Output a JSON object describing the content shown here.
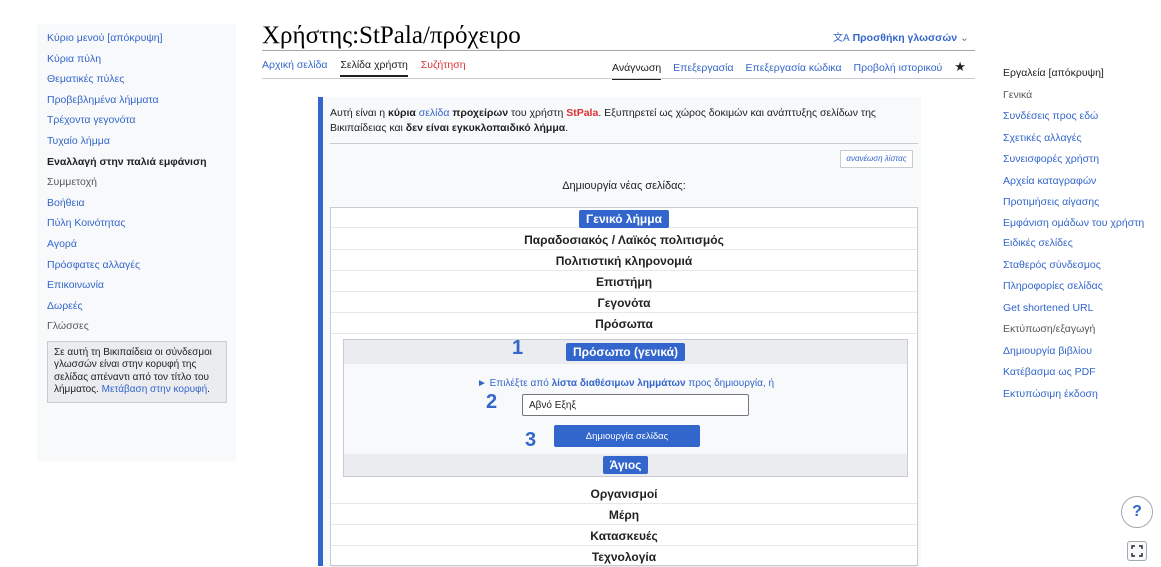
{
  "left_sidebar": {
    "items": [
      "Κύριο μενού [απόκρυψη]",
      "Κύρια πύλη",
      "Θεματικές πύλες",
      "Προβεβλημένα λήμματα",
      "Τρέχοντα γεγονότα",
      "Τυχαίο λήμμα",
      "Εναλλαγή στην παλιά εμφάνιση",
      "Συμμετοχή",
      "Βοήθεια",
      "Πύλη Κοινότητας",
      "Αγορά",
      "Πρόσφατες αλλαγές",
      "Επικοινωνία",
      "Δωρεές",
      "Γλώσσες"
    ],
    "notice_text": "Σε αυτή τη Βικιπαίδεια οι σύνδεσμοι γλωσσών είναι στην κορυφή της σελίδας απέναντι από τον τίτλο του λήμματος.",
    "notice_link": "Μετάβαση στην κορυφή",
    "notice_end": "."
  },
  "header": {
    "title": "Χρήστης:StPala/πρόχειρο",
    "add_languages": "Προσθήκη γλωσσών",
    "tabs_left": [
      "Αρχική σελίδα",
      "Σελίδα χρήστη",
      "Συζήτηση"
    ],
    "tabs_right": [
      "Ανάγνωση",
      "Επεξεργασία",
      "Επεξεργασία κώδικα",
      "Προβολή ιστορικού"
    ]
  },
  "right_sidebar": {
    "items": [
      "Εργαλεία [απόκρυψη]",
      "Γενικά",
      "Συνδέσεις προς εδώ",
      "Σχετικές αλλαγές",
      "Συνεισφορές χρήστη",
      "Αρχεία καταγραφών",
      "Προτιμήσεις αίγασης",
      "Εμφάνιση ομάδων του χρήστη",
      "Ειδικές σελίδες",
      "Σταθερός σύνδεσμος",
      "Πληροφορίες σελίδας",
      "Get shortened URL",
      "Εκτύπωση/εξαγωγή",
      "Δημιουργία βιβλίου",
      "Κατέβασμα ως PDF",
      "Εκτυπώσιμη έκδοση"
    ]
  },
  "intro": {
    "p1": "Αυτή είναι η ",
    "b1": "κύρια",
    "l1": " σελίδα",
    "p2": " ",
    "b2": "προχείρων",
    "p3": " του χρήστη ",
    "user": "StPala",
    "p4": ". Εξυπηρετεί ως χώρος δοκιμών και ανάπτυξης σελίδων της Βικιπαίδειας και ",
    "b3": "δεν είναι εγκυκλοπαιδικό λήμμα",
    "p5": "."
  },
  "refresh_cache": "ανανέωση λίστας",
  "create_heading": "Δημιουργία νέας σελίδας:",
  "categories": {
    "top_badge": "Γενικό λήμμα",
    "rows_before": [
      "Παραδοσιακός / Λαϊκός πολιτισμός",
      "Πολιτιστική κληρονομιά",
      "Επιστήμη",
      "Γεγονότα",
      "Πρόσωπα"
    ],
    "panel_badge": "Πρόσωπο (γενικά)",
    "choose_prefix": "► Επιλέξτε από ",
    "choose_link": "λίστα διαθέσιμων λημμάτων",
    "choose_suffix": " προς δημιουργία, ή",
    "input_value": "Αβνό Εξηξ",
    "create_button": "Δημιουργία σελίδας",
    "saint_badge": "Άγιος",
    "rows_after": [
      "Οργανισμοί",
      "Μέρη",
      "Κατασκευές",
      "Τεχνολογία"
    ]
  },
  "steps": [
    "1",
    "2",
    "3"
  ],
  "help_label": "?"
}
